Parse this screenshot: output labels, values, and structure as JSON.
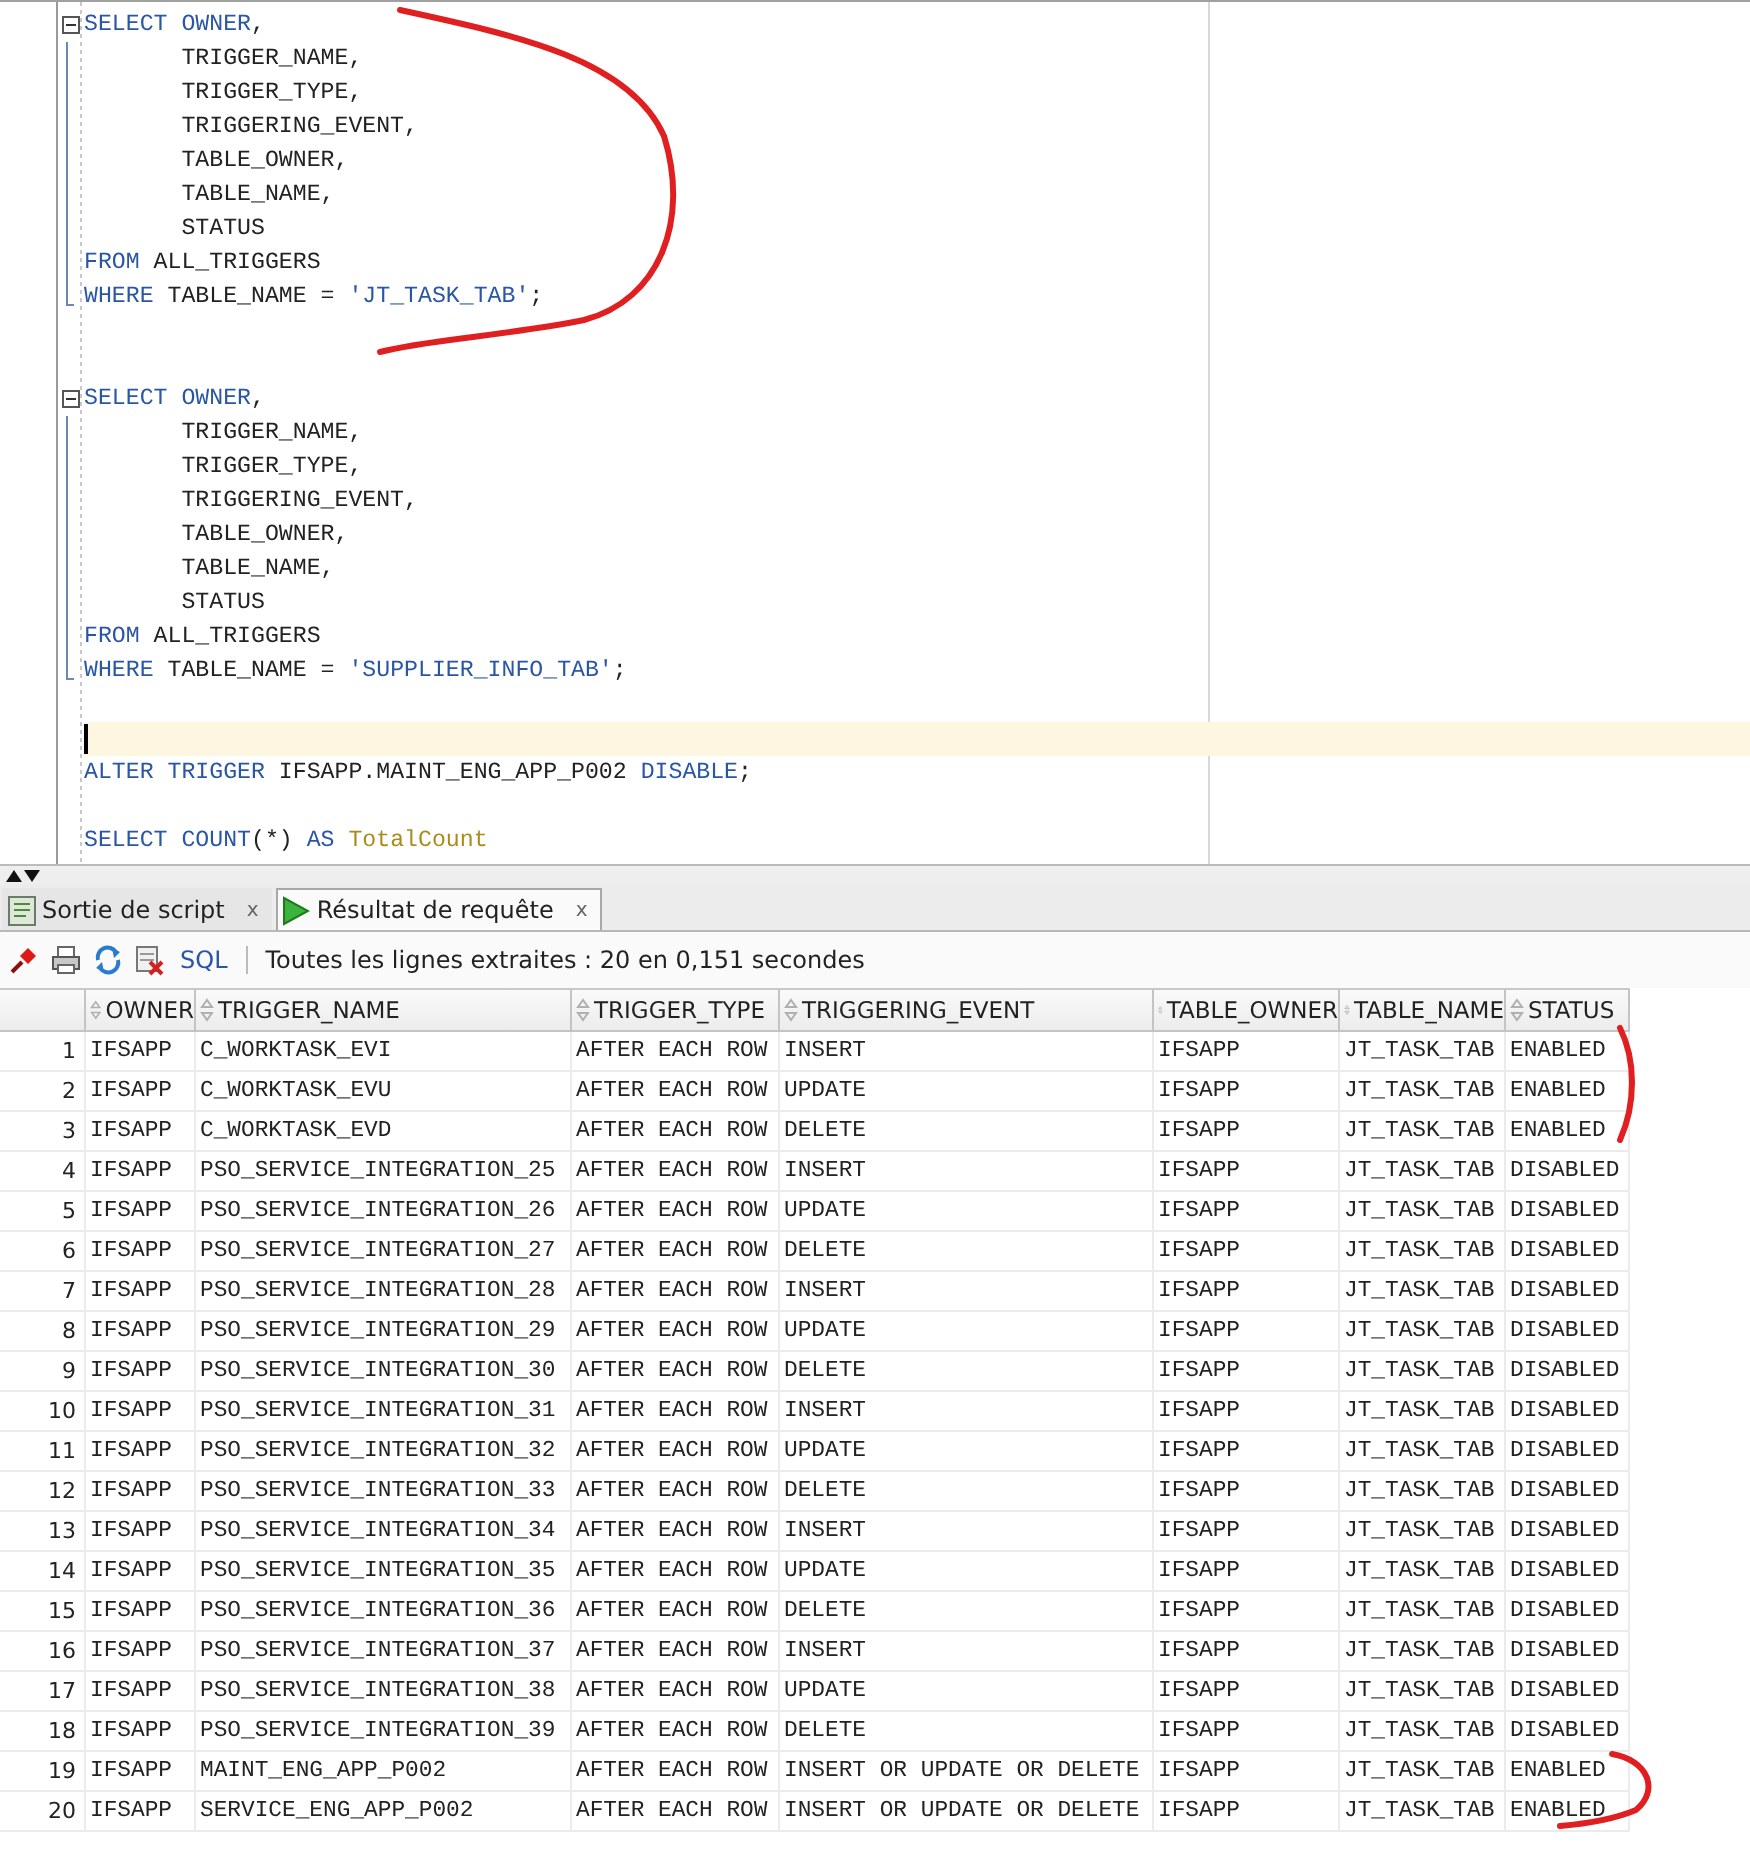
{
  "editor": {
    "lines": [
      {
        "kind": "foldstart",
        "current": false,
        "tokens": [
          {
            "kind": "keyword",
            "text": "SELECT"
          },
          {
            "kind": "keyword",
            "text": " OWNER"
          },
          {
            "kind": "plain",
            "text": ","
          }
        ]
      },
      {
        "kind": "foldbody",
        "current": false,
        "tokens": [
          {
            "kind": "plain",
            "text": "       TRIGGER_NAME,"
          }
        ]
      },
      {
        "kind": "foldbody",
        "current": false,
        "tokens": [
          {
            "kind": "plain",
            "text": "       TRIGGER_TYPE,"
          }
        ]
      },
      {
        "kind": "foldbody",
        "current": false,
        "tokens": [
          {
            "kind": "plain",
            "text": "       TRIGGERING_EVENT,"
          }
        ]
      },
      {
        "kind": "foldbody",
        "current": false,
        "tokens": [
          {
            "kind": "plain",
            "text": "       TABLE_OWNER,"
          }
        ]
      },
      {
        "kind": "foldbody",
        "current": false,
        "tokens": [
          {
            "kind": "plain",
            "text": "       TABLE_NAME,"
          }
        ]
      },
      {
        "kind": "foldbody",
        "current": false,
        "tokens": [
          {
            "kind": "plain",
            "text": "       STATUS"
          }
        ]
      },
      {
        "kind": "foldbody",
        "current": false,
        "tokens": [
          {
            "kind": "keyword",
            "text": "FROM"
          },
          {
            "kind": "plain",
            "text": " ALL_TRIGGERS"
          }
        ]
      },
      {
        "kind": "foldend",
        "current": false,
        "tokens": [
          {
            "kind": "keyword",
            "text": "WHERE"
          },
          {
            "kind": "plain",
            "text": " TABLE_NAME = "
          },
          {
            "kind": "string",
            "text": "'JT_TASK_TAB'"
          },
          {
            "kind": "plain",
            "text": ";"
          }
        ]
      },
      {
        "kind": "plain",
        "current": false
      },
      {
        "kind": "plain",
        "current": false
      },
      {
        "kind": "foldstart",
        "current": false,
        "tokens": [
          {
            "kind": "keyword",
            "text": "SELECT"
          },
          {
            "kind": "keyword",
            "text": " OWNER"
          },
          {
            "kind": "plain",
            "text": ","
          }
        ]
      },
      {
        "kind": "foldbody",
        "current": false,
        "tokens": [
          {
            "kind": "plain",
            "text": "       TRIGGER_NAME,"
          }
        ]
      },
      {
        "kind": "foldbody",
        "current": false,
        "tokens": [
          {
            "kind": "plain",
            "text": "       TRIGGER_TYPE,"
          }
        ]
      },
      {
        "kind": "foldbody",
        "current": false,
        "tokens": [
          {
            "kind": "plain",
            "text": "       TRIGGERING_EVENT,"
          }
        ]
      },
      {
        "kind": "foldbody",
        "current": false,
        "tokens": [
          {
            "kind": "plain",
            "text": "       TABLE_OWNER,"
          }
        ]
      },
      {
        "kind": "foldbody",
        "current": false,
        "tokens": [
          {
            "kind": "plain",
            "text": "       TABLE_NAME,"
          }
        ]
      },
      {
        "kind": "foldbody",
        "current": false,
        "tokens": [
          {
            "kind": "plain",
            "text": "       STATUS"
          }
        ]
      },
      {
        "kind": "foldbody",
        "current": false,
        "tokens": [
          {
            "kind": "keyword",
            "text": "FROM"
          },
          {
            "kind": "plain",
            "text": " ALL_TRIGGERS"
          }
        ]
      },
      {
        "kind": "foldend",
        "current": false,
        "tokens": [
          {
            "kind": "keyword",
            "text": "WHERE"
          },
          {
            "kind": "plain",
            "text": " TABLE_NAME = "
          },
          {
            "kind": "string",
            "text": "'SUPPLIER_INFO_TAB'"
          },
          {
            "kind": "plain",
            "text": ";"
          }
        ]
      },
      {
        "kind": "plain",
        "current": false
      },
      {
        "kind": "plain",
        "current": true
      },
      {
        "kind": "plain",
        "current": false,
        "tokens": [
          {
            "kind": "keyword",
            "text": "ALTER TRIGGER"
          },
          {
            "kind": "plain",
            "text": " IFSAPP.MAINT_ENG_APP_P002"
          },
          {
            "kind": "keyword",
            "text": " DISABLE"
          },
          {
            "kind": "plain",
            "text": ";"
          }
        ]
      },
      {
        "kind": "plain",
        "current": false
      },
      {
        "kind": "plain",
        "current": false,
        "tokens": [
          {
            "kind": "keyword",
            "text": "SELECT"
          },
          {
            "kind": "keyword",
            "text": " COUNT"
          },
          {
            "kind": "plain",
            "text": "(*)"
          },
          {
            "kind": "keyword",
            "text": " AS"
          },
          {
            "kind": "alias",
            "text": " TotalCount"
          }
        ]
      }
    ]
  },
  "tabs": [
    {
      "label": "Sortie de script",
      "close": "x",
      "kind": "script",
      "selected": false
    },
    {
      "label": "Résultat de requête",
      "close": "x",
      "kind": "result",
      "selected": true
    }
  ],
  "toolbar": {
    "sql_link": "SQL",
    "status": "Toutes les lignes extraites : 20 en 0,151 secondes"
  },
  "table": {
    "columns": [
      "OWNER",
      "TRIGGER_NAME",
      "TRIGGER_TYPE",
      "TRIGGERING_EVENT",
      "TABLE_OWNER",
      "TABLE_NAME",
      "STATUS"
    ],
    "rows": [
      {
        "number": "1",
        "cells": [
          "IFSAPP",
          "C_WORKTASK_EVI",
          "AFTER EACH ROW",
          "INSERT",
          "IFSAPP",
          "JT_TASK_TAB",
          "ENABLED"
        ]
      },
      {
        "number": "2",
        "cells": [
          "IFSAPP",
          "C_WORKTASK_EVU",
          "AFTER EACH ROW",
          "UPDATE",
          "IFSAPP",
          "JT_TASK_TAB",
          "ENABLED"
        ]
      },
      {
        "number": "3",
        "cells": [
          "IFSAPP",
          "C_WORKTASK_EVD",
          "AFTER EACH ROW",
          "DELETE",
          "IFSAPP",
          "JT_TASK_TAB",
          "ENABLED"
        ]
      },
      {
        "number": "4",
        "cells": [
          "IFSAPP",
          "PSO_SERVICE_INTEGRATION_25",
          "AFTER EACH ROW",
          "INSERT",
          "IFSAPP",
          "JT_TASK_TAB",
          "DISABLED"
        ]
      },
      {
        "number": "5",
        "cells": [
          "IFSAPP",
          "PSO_SERVICE_INTEGRATION_26",
          "AFTER EACH ROW",
          "UPDATE",
          "IFSAPP",
          "JT_TASK_TAB",
          "DISABLED"
        ]
      },
      {
        "number": "6",
        "cells": [
          "IFSAPP",
          "PSO_SERVICE_INTEGRATION_27",
          "AFTER EACH ROW",
          "DELETE",
          "IFSAPP",
          "JT_TASK_TAB",
          "DISABLED"
        ]
      },
      {
        "number": "7",
        "cells": [
          "IFSAPP",
          "PSO_SERVICE_INTEGRATION_28",
          "AFTER EACH ROW",
          "INSERT",
          "IFSAPP",
          "JT_TASK_TAB",
          "DISABLED"
        ]
      },
      {
        "number": "8",
        "cells": [
          "IFSAPP",
          "PSO_SERVICE_INTEGRATION_29",
          "AFTER EACH ROW",
          "UPDATE",
          "IFSAPP",
          "JT_TASK_TAB",
          "DISABLED"
        ]
      },
      {
        "number": "9",
        "cells": [
          "IFSAPP",
          "PSO_SERVICE_INTEGRATION_30",
          "AFTER EACH ROW",
          "DELETE",
          "IFSAPP",
          "JT_TASK_TAB",
          "DISABLED"
        ]
      },
      {
        "number": "10",
        "cells": [
          "IFSAPP",
          "PSO_SERVICE_INTEGRATION_31",
          "AFTER EACH ROW",
          "INSERT",
          "IFSAPP",
          "JT_TASK_TAB",
          "DISABLED"
        ]
      },
      {
        "number": "11",
        "cells": [
          "IFSAPP",
          "PSO_SERVICE_INTEGRATION_32",
          "AFTER EACH ROW",
          "UPDATE",
          "IFSAPP",
          "JT_TASK_TAB",
          "DISABLED"
        ]
      },
      {
        "number": "12",
        "cells": [
          "IFSAPP",
          "PSO_SERVICE_INTEGRATION_33",
          "AFTER EACH ROW",
          "DELETE",
          "IFSAPP",
          "JT_TASK_TAB",
          "DISABLED"
        ]
      },
      {
        "number": "13",
        "cells": [
          "IFSAPP",
          "PSO_SERVICE_INTEGRATION_34",
          "AFTER EACH ROW",
          "INSERT",
          "IFSAPP",
          "JT_TASK_TAB",
          "DISABLED"
        ]
      },
      {
        "number": "14",
        "cells": [
          "IFSAPP",
          "PSO_SERVICE_INTEGRATION_35",
          "AFTER EACH ROW",
          "UPDATE",
          "IFSAPP",
          "JT_TASK_TAB",
          "DISABLED"
        ]
      },
      {
        "number": "15",
        "cells": [
          "IFSAPP",
          "PSO_SERVICE_INTEGRATION_36",
          "AFTER EACH ROW",
          "DELETE",
          "IFSAPP",
          "JT_TASK_TAB",
          "DISABLED"
        ]
      },
      {
        "number": "16",
        "cells": [
          "IFSAPP",
          "PSO_SERVICE_INTEGRATION_37",
          "AFTER EACH ROW",
          "INSERT",
          "IFSAPP",
          "JT_TASK_TAB",
          "DISABLED"
        ]
      },
      {
        "number": "17",
        "cells": [
          "IFSAPP",
          "PSO_SERVICE_INTEGRATION_38",
          "AFTER EACH ROW",
          "UPDATE",
          "IFSAPP",
          "JT_TASK_TAB",
          "DISABLED"
        ]
      },
      {
        "number": "18",
        "cells": [
          "IFSAPP",
          "PSO_SERVICE_INTEGRATION_39",
          "AFTER EACH ROW",
          "DELETE",
          "IFSAPP",
          "JT_TASK_TAB",
          "DISABLED"
        ]
      },
      {
        "number": "19",
        "cells": [
          "IFSAPP",
          "MAINT_ENG_APP_P002",
          "AFTER EACH ROW",
          "INSERT OR UPDATE OR DELETE",
          "IFSAPP",
          "JT_TASK_TAB",
          "ENABLED"
        ]
      },
      {
        "number": "20",
        "cells": [
          "IFSAPP",
          "SERVICE_ENG_APP_P002",
          "AFTER EACH ROW",
          "INSERT OR UPDATE OR DELETE",
          "IFSAPP",
          "JT_TASK_TAB",
          "ENABLED"
        ]
      }
    ]
  }
}
